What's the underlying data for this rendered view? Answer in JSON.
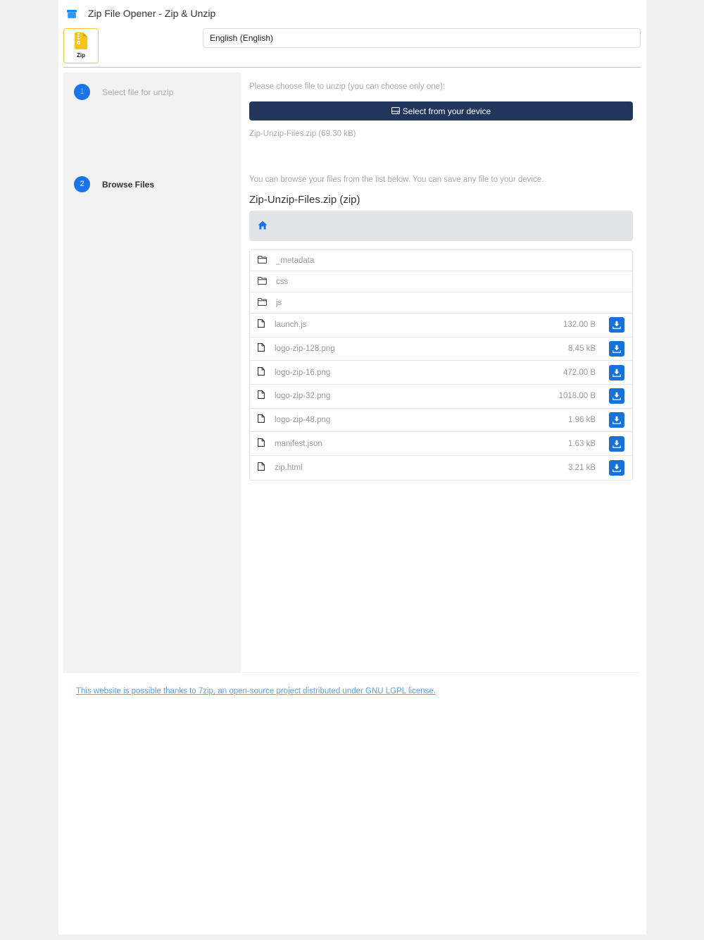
{
  "app": {
    "title": "Zip File Opener - Zip & Unzip",
    "logo_icon": "archive-box-icon",
    "tile_label": "Zip",
    "tile_icon": "zip-file-icon"
  },
  "language": {
    "selected": "English (English)"
  },
  "steps": [
    {
      "number": "1",
      "label": "Select file for unzip"
    },
    {
      "number": "2",
      "label": "Browse Files"
    }
  ],
  "select_step": {
    "instruction": "Please choose file to unzip (you can choose only one):",
    "button_label": "Select from your device",
    "selected_file": "Zip-Unzip-Files.zip (69.30 kB)"
  },
  "browse_step": {
    "instruction": "You can browse your files from the list below. You can save any file to your device.",
    "archive_title": "Zip-Unzip-Files.zip (zip)",
    "breadcrumb_icon": "home-icon",
    "folders": [
      {
        "name": "_metadata"
      },
      {
        "name": "css"
      },
      {
        "name": "js"
      }
    ],
    "files": [
      {
        "name": "launch.js",
        "size": "132.00 B"
      },
      {
        "name": "logo-zip-128.png",
        "size": "8.45 kB"
      },
      {
        "name": "logo-zip-16.png",
        "size": "472.00 B"
      },
      {
        "name": "logo-zip-32.png",
        "size": "1018.00 B"
      },
      {
        "name": "logo-zip-48.png",
        "size": "1.96 kB"
      },
      {
        "name": "manifest.json",
        "size": "1.63 kB"
      },
      {
        "name": "zip.html",
        "size": "3.21 kB"
      }
    ]
  },
  "footer": {
    "link_text": "This website is possible thanks to 7zip, an open-source project distributed under GNU LGPL license."
  },
  "colors": {
    "accent": "#1a73e8",
    "button_dark": "#22355a",
    "download_button": "#1672d6",
    "tile_border": "#f0c73a",
    "zip_yellow": "#f5c518"
  }
}
